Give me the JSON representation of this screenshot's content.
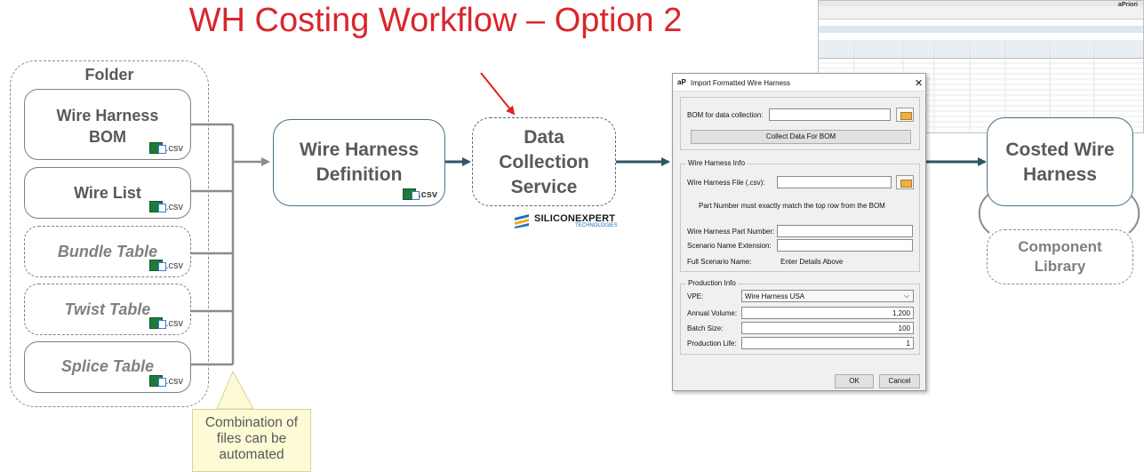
{
  "title": "WH Costing Workflow – Option 2",
  "folder": {
    "title": "Folder",
    "files": [
      {
        "label": "Wire Harness BOM",
        "ext": ".csv"
      },
      {
        "label": "Wire List",
        "ext": ".csv"
      },
      {
        "label": "Bundle Table",
        "ext": ".csv"
      },
      {
        "label": "Twist Table",
        "ext": ".csv"
      },
      {
        "label": "Splice Table",
        "ext": ".csv"
      }
    ]
  },
  "definition": {
    "label": "Wire Harness Definition",
    "ext": ".csv"
  },
  "data_collection": {
    "label": "Data Collection Service"
  },
  "siliconexpert": {
    "name": "SILICONEXPERT",
    "sub": "TECHNOLOGIES"
  },
  "costed": {
    "label": "Costed Wire Harness"
  },
  "library": {
    "label": "Component Library"
  },
  "note": "Combination of files can be automated",
  "dialog": {
    "logo": "aP",
    "title": "Import Formatted Wire Harness",
    "close": "✕",
    "bom_label": "BOM for data collection:",
    "bom_value": "",
    "collect_button": "Collect Data For BOM",
    "wire_info_label": "Wire Harness Info",
    "wire_file_label": "Wire Harness File (.csv):",
    "wire_file_value": "",
    "part_note": "Part Number must exactly match the top row from the BOM",
    "part_number_label": "Wire Harness Part Number:",
    "part_number_value": "",
    "scenario_ext_label": "Scenario Name Extension:",
    "scenario_ext_value": "",
    "full_scenario_label": "Full Scenario Name:",
    "full_scenario_value": "Enter Details Above",
    "production_info_label": "Production Info",
    "vpe_label": "VPE:",
    "vpe_value": "Wire Harness USA",
    "annual_volume_label": "Annual Volume:",
    "annual_volume_value": "1,200",
    "batch_size_label": "Batch Size:",
    "batch_size_value": "100",
    "production_life_label": "Production Life:",
    "production_life_value": "1",
    "ok_button": "OK",
    "cancel_button": "Cancel"
  },
  "colors": {
    "title": "#d9262b",
    "arrow": "#2f5466",
    "accent_arrow": "#e02020",
    "note_bg": "#fdfbd6"
  }
}
